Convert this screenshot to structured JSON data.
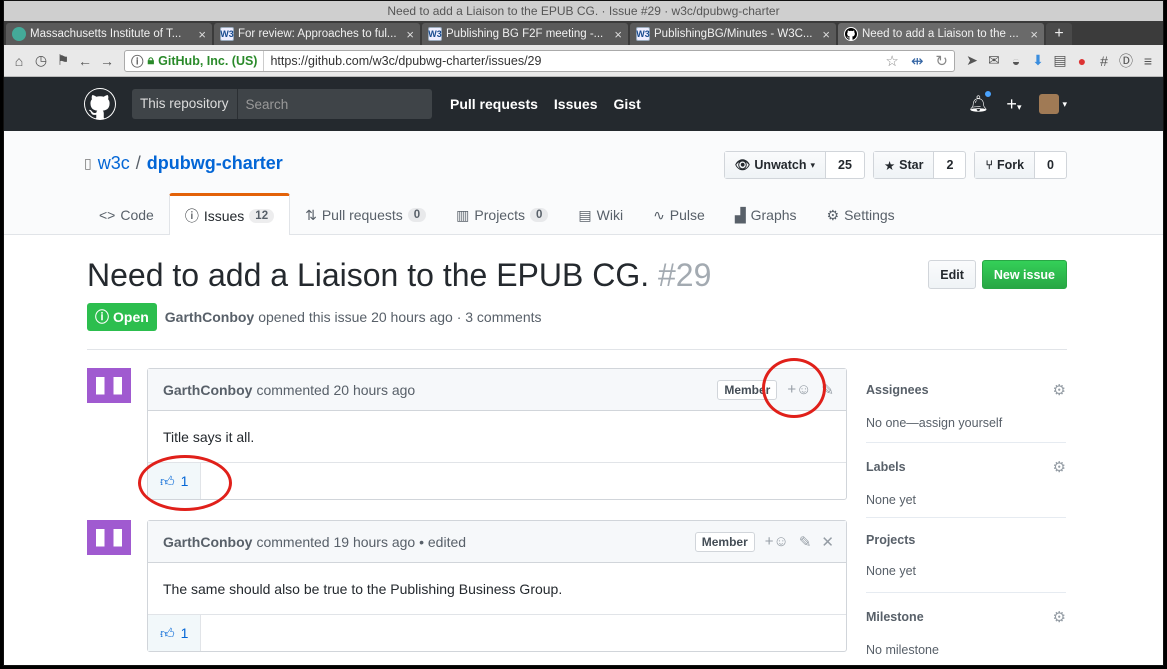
{
  "window": {
    "title": "Need to add a Liaison to the EPUB CG. · Issue #29 · w3c/dpubwg-charter"
  },
  "tabs": [
    {
      "label": "Massachusetts Institute of T...",
      "icon": "mit-favicon"
    },
    {
      "label": "For review: Approaches to ful...",
      "icon": "w3c-favicon"
    },
    {
      "label": "Publishing BG F2F meeting -...",
      "icon": "w3c-favicon"
    },
    {
      "label": "PublishingBG/Minutes - W3C...",
      "icon": "w3c-favicon"
    },
    {
      "label": "Need to add a Liaison to the ...",
      "icon": "github-favicon"
    }
  ],
  "toolbar": {
    "security_label": "GitHub, Inc. (US)",
    "url": "https://github.com/w3c/dpubwg-charter/issues/29"
  },
  "gh": {
    "scope": "This repository",
    "search_placeholder": "Search",
    "nav": [
      "Pull requests",
      "Issues",
      "Gist"
    ]
  },
  "repo": {
    "owner": "w3c",
    "separator": "/",
    "name": "dpubwg-charter",
    "unwatch_label": "Unwatch",
    "watch_count": "25",
    "star_label": "Star",
    "star_count": "2",
    "fork_label": "Fork",
    "fork_count": "0",
    "tabs": [
      {
        "label": "Code",
        "count": ""
      },
      {
        "label": "Issues",
        "count": "12"
      },
      {
        "label": "Pull requests",
        "count": "0"
      },
      {
        "label": "Projects",
        "count": "0"
      },
      {
        "label": "Wiki",
        "count": ""
      },
      {
        "label": "Pulse",
        "count": ""
      },
      {
        "label": "Graphs",
        "count": ""
      },
      {
        "label": "Settings",
        "count": ""
      }
    ]
  },
  "issue": {
    "title": "Need to add a Liaison to the EPUB CG.",
    "number": "#29",
    "edit_label": "Edit",
    "new_issue_label": "New issue",
    "state": "Open",
    "author": "GarthConboy",
    "meta_text": "opened this issue 20 hours ago · 3 comments"
  },
  "comments": [
    {
      "author": "GarthConboy",
      "meta": "commented 20 hours ago",
      "badge": "Member",
      "body": "Title says it all.",
      "reaction_count": "1"
    },
    {
      "author": "GarthConboy",
      "meta": "commented 19 hours ago • edited",
      "badge": "Member",
      "body": "The same should also be true to the Publishing Business Group.",
      "reaction_count": "1"
    }
  ],
  "sidebar": {
    "assignees": {
      "label": "Assignees",
      "value": "No one—assign yourself"
    },
    "labels": {
      "label": "Labels",
      "value": "None yet"
    },
    "projects": {
      "label": "Projects",
      "value": "None yet"
    },
    "milestone": {
      "label": "Milestone",
      "value": "No milestone"
    }
  }
}
